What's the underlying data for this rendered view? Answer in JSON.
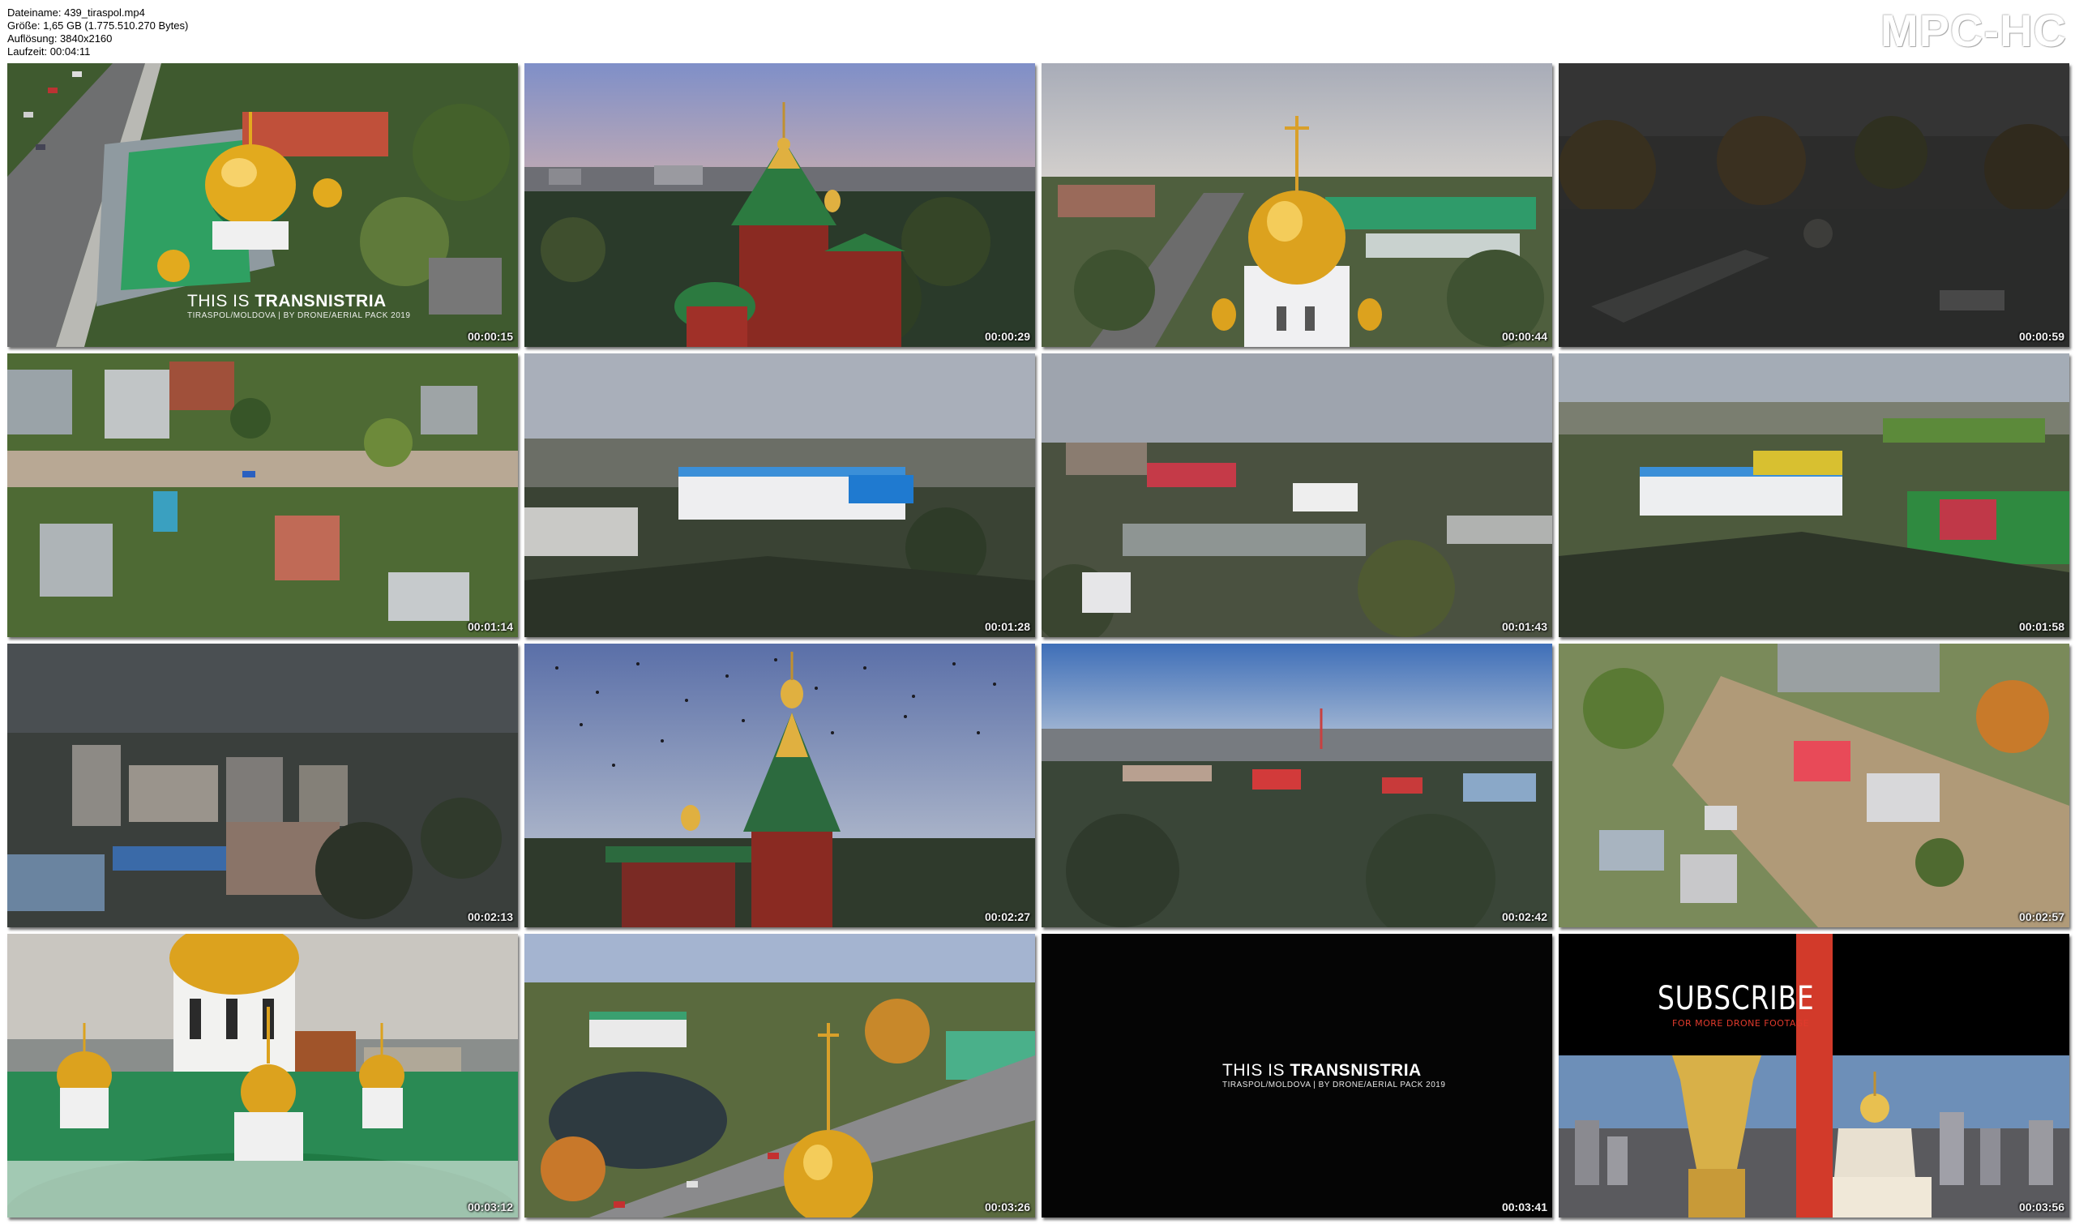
{
  "file_info": {
    "filename": "Dateiname: 439_tiraspol.mp4",
    "size": "Größe: 1,65 GB (1.775.510.270 Bytes)",
    "resolution": "Auflösung: 3840x2160",
    "duration": "Laufzeit: 00:04:11"
  },
  "app": {
    "brand": "MPC-HC"
  },
  "overlays": {
    "intro_title_prefix": "THIS IS ",
    "intro_title_bold": "TRANSNISTRIA",
    "intro_subtitle": "TIRASPOL/MOLDOVA | BY DRONE/AERIAL PACK 2019",
    "subscribe": "SUBSCRIBE",
    "subscribe_tag": "FOR MORE DRONE FOOTAGE"
  },
  "thumbnails": [
    {
      "time": "00:00:15",
      "scene": "green-church-street"
    },
    {
      "time": "00:00:29",
      "scene": "red-church-dusk"
    },
    {
      "time": "00:00:44",
      "scene": "golden-dome-street"
    },
    {
      "time": "00:00:59",
      "scene": "dark-park"
    },
    {
      "time": "00:01:14",
      "scene": "topdown-houses"
    },
    {
      "time": "00:01:28",
      "scene": "stadium-wide"
    },
    {
      "time": "00:01:43",
      "scene": "city-square"
    },
    {
      "time": "00:01:58",
      "scene": "stadium-fields"
    },
    {
      "time": "00:02:13",
      "scene": "dusk-apartments"
    },
    {
      "time": "00:02:27",
      "scene": "church-birds"
    },
    {
      "time": "00:02:42",
      "scene": "city-evening"
    },
    {
      "time": "00:02:57",
      "scene": "topdown-red-roof"
    },
    {
      "time": "00:03:12",
      "scene": "white-church-domes"
    },
    {
      "time": "00:03:26",
      "scene": "river-park-dome"
    },
    {
      "time": "00:03:41",
      "scene": "black-title"
    },
    {
      "time": "00:03:56",
      "scene": "subscribe-end"
    }
  ],
  "colors": {
    "gold": "#e0a820",
    "church_green": "#2e9a57",
    "church_red": "#a23028",
    "sky_blue": "#8fa7cc",
    "subscribe_red": "#d23a2a"
  }
}
